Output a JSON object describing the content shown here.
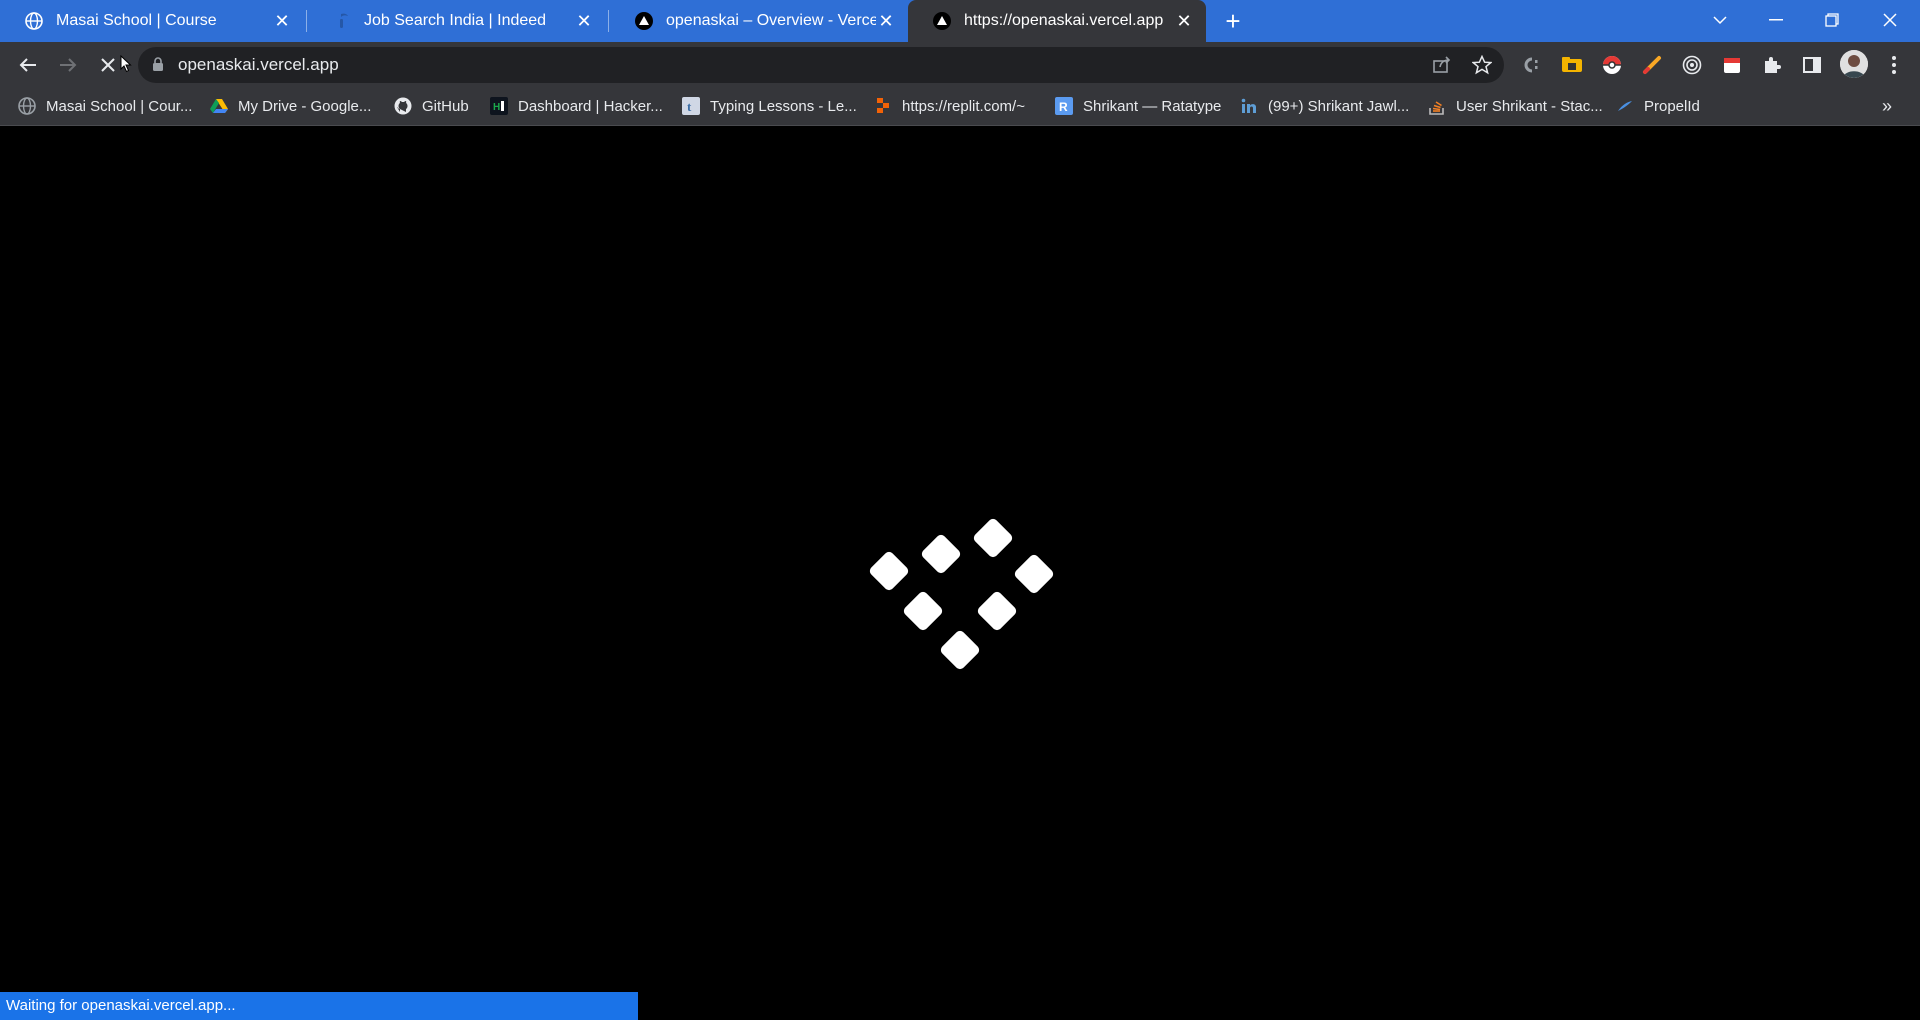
{
  "tabs": [
    {
      "title": "Masai School | Course",
      "icon": "globe-icon"
    },
    {
      "title": "Job Search India | Indeed",
      "icon": "indeed-icon"
    },
    {
      "title": "openaskai – Overview - Vercel",
      "icon": "vercel-icon"
    },
    {
      "title": "https://openaskai.vercel.app",
      "icon": "vercel-icon",
      "active": true
    }
  ],
  "address_bar": {
    "url": "openaskai.vercel.app"
  },
  "bookmarks": [
    {
      "label": "Masai School | Cour...",
      "icon": "globe-icon"
    },
    {
      "label": "My Drive - Google...",
      "icon": "google-drive-icon"
    },
    {
      "label": "GitHub",
      "icon": "github-icon"
    },
    {
      "label": "Dashboard | Hacker...",
      "icon": "hackerrank-icon"
    },
    {
      "label": "Typing Lessons - Le...",
      "icon": "typing-icon"
    },
    {
      "label": "https://replit.com/~",
      "icon": "replit-icon"
    },
    {
      "label": "Shrikant — Ratatype",
      "icon": "ratatype-icon"
    },
    {
      "label": "(99+) Shrikant Jawl...",
      "icon": "linkedin-icon"
    },
    {
      "label": "User Shrikant - Stac...",
      "icon": "stackoverflow-icon"
    },
    {
      "label": "PropelId",
      "icon": "propel-icon"
    }
  ],
  "status": {
    "text": "Waiting for openaskai.vercel.app..."
  },
  "colors": {
    "tab_strip": "#2f6fd6",
    "toolbar": "#35363a",
    "status_bar": "#1a73e8",
    "page_background": "#000000"
  }
}
